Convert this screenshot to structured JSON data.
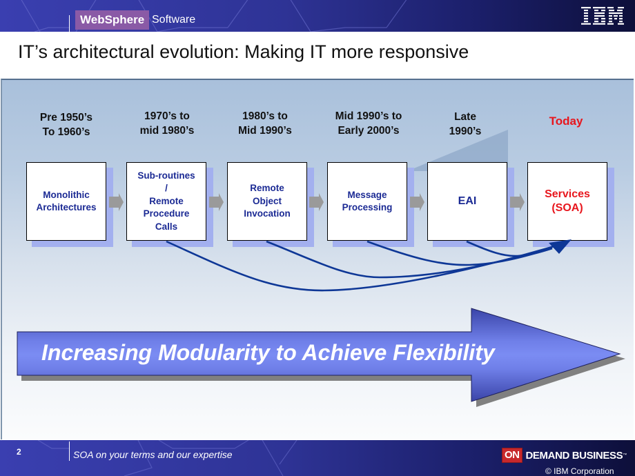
{
  "header": {
    "product_badge": "WebSphere",
    "product_suffix": "Software",
    "brand_logo": "IBM"
  },
  "slide": {
    "title": "IT’s architectural evolution: Making IT more responsive"
  },
  "timeline": {
    "stages": [
      {
        "era_line1": "Pre 1950’s",
        "era_line2": "To 1960’s",
        "label_lines": [
          "Monolithic",
          "Architectures"
        ]
      },
      {
        "era_line1": "1970’s to",
        "era_line2": "mid 1980’s",
        "label_lines": [
          "Sub-routines",
          "/",
          "Remote",
          "Procedure",
          "Calls"
        ]
      },
      {
        "era_line1": "1980’s to",
        "era_line2": "Mid 1990’s",
        "label_lines": [
          "Remote",
          "Object",
          "Invocation"
        ]
      },
      {
        "era_line1": "Mid 1990’s to",
        "era_line2": "Early 2000’s",
        "label_lines": [
          "Message",
          "Processing"
        ]
      },
      {
        "era_line1": "Late",
        "era_line2": "1990’s",
        "label_lines": [
          "EAI"
        ]
      },
      {
        "era_line1": "Today",
        "era_line2": "",
        "label_lines": [
          "Services",
          "(SOA)"
        ]
      }
    ],
    "connectors": "stages 2–5 each curve into Services (SOA)",
    "highlight_color": "#e8161d",
    "label_color": "#1b2a94",
    "curve_color": "#0e3796"
  },
  "banner": {
    "text": "Increasing Modularity to Achieve Flexibility",
    "fill_color": "#6f7fe8"
  },
  "footer": {
    "page_number": "2",
    "tagline": "SOA on your terms and our expertise",
    "odb_on": "ON",
    "odb_text": "DEMAND BUSINESS",
    "odb_tm": "™",
    "copyright": "© IBM Corporation"
  }
}
